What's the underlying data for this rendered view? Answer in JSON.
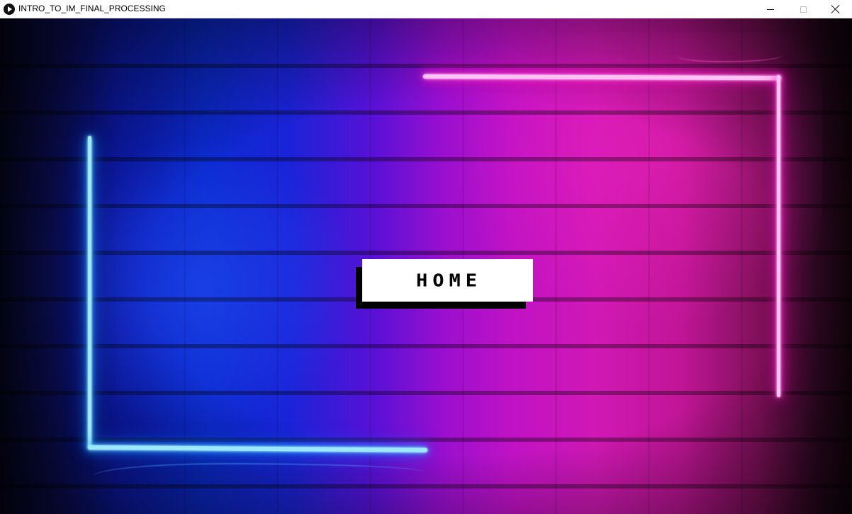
{
  "window": {
    "title": "INTRO_TO_IM_FINAL_PROCESSING",
    "app_icon": "processing-play-icon",
    "controls": {
      "minimize_icon": "minimize-icon",
      "maximize_icon": "maximize-icon",
      "close_icon": "close-icon"
    }
  },
  "scene": {
    "background": "neon-brick-wall",
    "colors": {
      "left_neon": "#40c8ff",
      "right_neon": "#ff45d8",
      "wall_blue": "#0b2ad0",
      "wall_magenta": "#c012c5"
    }
  },
  "home_button": {
    "label": "HOME",
    "background": "#ffffff",
    "text_color": "#000000",
    "shadow_color": "#000000"
  }
}
